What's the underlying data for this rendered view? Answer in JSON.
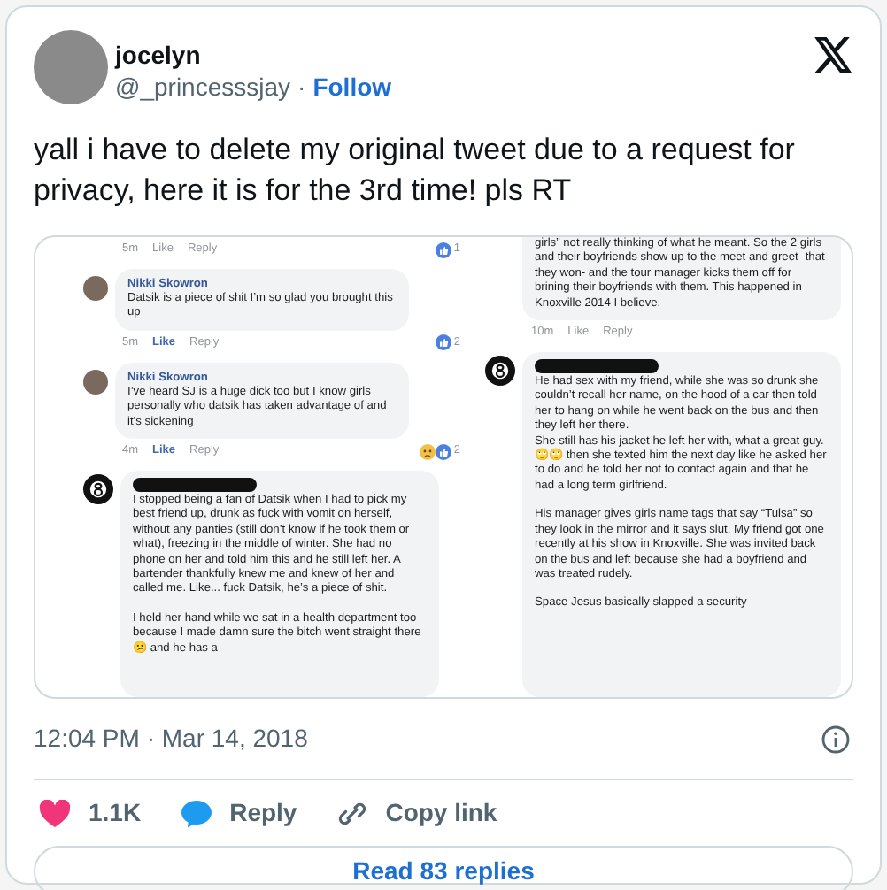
{
  "author": {
    "name": "jocelyn",
    "handle": "@_princesssjay",
    "separator": "·",
    "follow": "Follow"
  },
  "text": "yall i have to delete my original tweet due to a request for privacy, here it is for the 3rd time! pls RT",
  "image": {
    "columns": [
      [
        {
          "kind": "footer",
          "time": "5m",
          "like": "Like",
          "reply": "Reply",
          "liked": false,
          "count": "1"
        },
        {
          "kind": "named_comment",
          "author": "Nikki Skowron",
          "paragraphs": [
            "Datsik is a piece of shit I’m so glad you brought this up"
          ]
        },
        {
          "kind": "footer",
          "time": "5m",
          "like": "Like",
          "reply": "Reply",
          "liked": true,
          "count": "2"
        },
        {
          "kind": "named_comment",
          "author": "Nikki Skowron",
          "paragraphs": [
            "I’ve heard SJ is a huge dick too but I know girls personally who datsik has taken advantage of and it’s sickening"
          ]
        },
        {
          "kind": "footer",
          "time": "4m",
          "like": "Like",
          "reply": "Reply",
          "liked": true,
          "sad_reaction": true,
          "count": "2"
        },
        {
          "kind": "redacted_comment",
          "paragraphs": [
            "I stopped being a fan of Datsik when I had to pick my best friend up, drunk as fuck with vomit on herself, without any panties (still don’t know if he took them or what), freezing in the middle of winter. She had no phone on her and told him this and he still left her. A bartender thankfully knew me and knew of her and called me. Like... fuck Datsik, he’s a piece of shit.",
            "I held her hand while we sat in a health department too because I made damn sure the bitch went straight there 😕 and he has a"
          ]
        }
      ],
      [
        {
          "kind": "clipped_comment",
          "paragraphs": [
            "girls” not really thinking of what he meant. So the 2 girls and their boyfriends show up to the meet and greet- that they won- and the tour manager kicks them off for brining their boyfriends with them. This happened in Knoxville 2014 I believe."
          ]
        },
        {
          "kind": "footer",
          "time": "10m",
          "like": "Like",
          "reply": "Reply",
          "liked": false
        },
        {
          "kind": "redacted_comment",
          "paragraphs": [
            "He had sex with my friend, while she was so drunk she couldn’t recall her name, on the hood of a car then told her to hang on while he went back on the bus and then they left her there.\nShe still has his jacket he left her with, what a great guy. 🙄🙄 then she texted him the next day like he asked her to do and he told her not to contact again and that he had a long term girlfriend.",
            "His manager gives girls name tags that say “Tulsa” so they look in the mirror and it says slut. My friend got one recently at his show in Knoxville. She was invited back on the bus and left because she had a boyfriend and was treated rudely.",
            "Space Jesus basically slapped a security"
          ]
        }
      ]
    ]
  },
  "timestamp": "12:04 PM · Mar 14, 2018",
  "actions": [
    {
      "kind": "like",
      "label": "1.1K"
    },
    {
      "kind": "reply",
      "label": "Reply"
    },
    {
      "kind": "copy",
      "label": "Copy link"
    }
  ],
  "read_replies": "Read 83 replies"
}
